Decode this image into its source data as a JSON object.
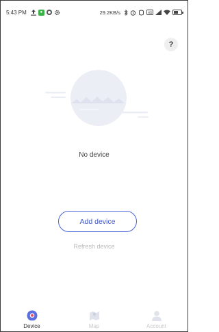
{
  "status_bar": {
    "time": "5:43 PM",
    "speed": "29.2KB/s",
    "icons_left": [
      "upload-icon",
      "app-notification-icon",
      "circle-icon",
      "settings-icon"
    ],
    "icons_right": [
      "bluetooth-icon",
      "alarm-icon",
      "nfc-icon",
      "signal-icon",
      "wifi-icon",
      "battery-icon"
    ]
  },
  "help": {
    "label": "?"
  },
  "empty_state": {
    "message": "No device",
    "add_button": "Add device",
    "refresh_link": "Refresh device"
  },
  "nav": {
    "items": [
      {
        "label": "Device",
        "icon": "device-icon",
        "active": true
      },
      {
        "label": "Map",
        "icon": "map-icon",
        "active": false
      },
      {
        "label": "Account",
        "icon": "account-icon",
        "active": false
      }
    ]
  },
  "colors": {
    "accent": "#3b54cf",
    "device_icon": "#5b6fe0",
    "device_icon_inner": "#e84e6a",
    "inactive": "#c9c9c9",
    "illustration": "#e9ebf4"
  }
}
